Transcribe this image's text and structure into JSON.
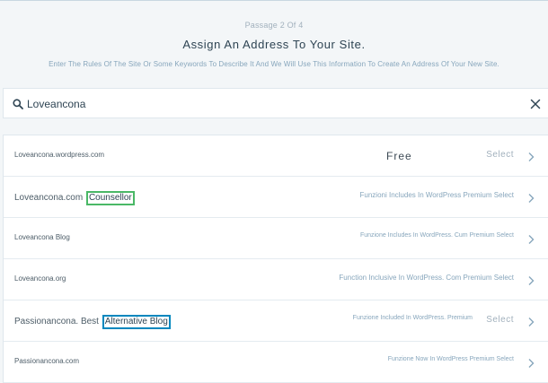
{
  "header": {
    "step": "Passage 2 Of 4",
    "title": "Assign An Address To Your Site.",
    "subtitle": "Enter The Rules Of The Site Or Some Keywords To Describe It And We Will Use This Information To Create An Address Of Your New Site."
  },
  "search": {
    "value": "Loveancona",
    "icon": "search-icon",
    "clear_icon": "close-icon"
  },
  "results": [
    {
      "domain": "Loveancona.wordpress.com",
      "tag": "",
      "price": "Free",
      "action": "Select"
    },
    {
      "domain": "Loveancona.com",
      "tag": "Counsellor",
      "price": "Funzioni Includes In WordPress Premium Select"
    },
    {
      "domain": "Loveancona Blog",
      "tag": "",
      "price": "Funzione Includes In WordPress. Cum Premium Select"
    },
    {
      "domain": "Loveancona.org",
      "tag": "",
      "price": "Function Inclusive In WordPress. Com Premium Select"
    },
    {
      "domain": "Passionancona. Best",
      "tag": "Alternative Blog",
      "price": "Funzione Included In WordPress. Premium",
      "action": "Select"
    },
    {
      "domain": "Passionancona.com",
      "tag": "",
      "price": "Funzione Now In WordPress Premium Select"
    }
  ],
  "colors": {
    "accent_green": "#4ab866",
    "accent_blue": "#0087be",
    "background": "#f3f6f8"
  }
}
